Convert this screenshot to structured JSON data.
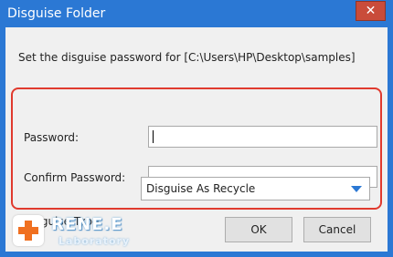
{
  "window": {
    "title": "Disguise Folder",
    "close_glyph": "✕"
  },
  "message": "Set the disguise password for [C:\\Users\\HP\\Desktop\\samples]",
  "form": {
    "password_label": "Password:",
    "password_value": "",
    "confirm_label": "Confirm Password:",
    "confirm_value": "",
    "type_label": "Disguise Type:",
    "type_selected": "Disguise As Recycle"
  },
  "buttons": {
    "ok": "OK",
    "cancel": "Cancel"
  },
  "brand": {
    "name": "RENE.E",
    "sub": "Laboratory"
  },
  "colors": {
    "titlebar": "#2b78d4",
    "highlight": "#e03a2e",
    "logo_cross": "#f07020"
  }
}
